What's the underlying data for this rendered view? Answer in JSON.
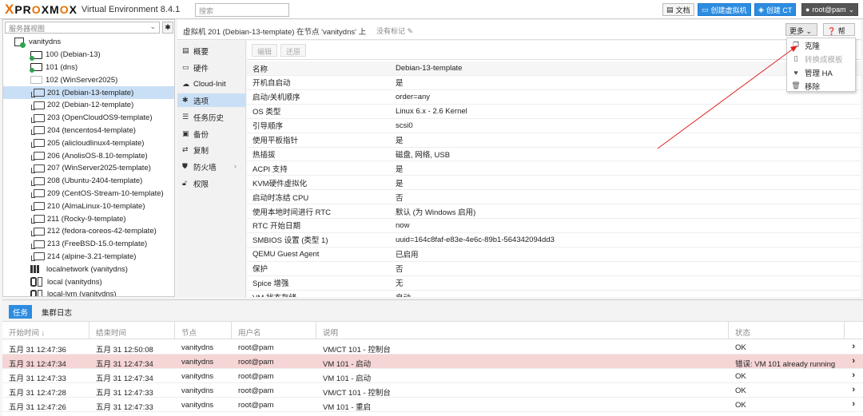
{
  "topbar": {
    "logo_x": "X",
    "logo_word_a": "PR",
    "logo_word_o": "O",
    "logo_word_b": "XM",
    "logo_word_o2": "O",
    "logo_word_c": "X",
    "version": "Virtual Environment 8.4.1",
    "search_placeholder": "搜索",
    "docs": "文档",
    "create_vm": "创建虚拟机",
    "create_ct": "创建 CT",
    "user": "root@pam"
  },
  "left": {
    "view_label": "服务器视图",
    "tree": [
      {
        "label": "vanitydns",
        "kind": "node"
      },
      {
        "label": "100 (Debian-13)",
        "kind": "vm-run"
      },
      {
        "label": "101 (dns)",
        "kind": "vm-run"
      },
      {
        "label": "102 (WinServer2025)",
        "kind": "vm-off"
      },
      {
        "label": "201 (Debian-13-template)",
        "kind": "tmpl"
      },
      {
        "label": "202 (Debian-12-template)",
        "kind": "tmpl"
      },
      {
        "label": "203 (OpenCloudOS9-template)",
        "kind": "tmpl"
      },
      {
        "label": "204 (tencentos4-template)",
        "kind": "tmpl"
      },
      {
        "label": "205 (alicloudlinux4-template)",
        "kind": "tmpl"
      },
      {
        "label": "206 (AnolisOS-8.10-template)",
        "kind": "tmpl"
      },
      {
        "label": "207 (WinServer2025-template)",
        "kind": "tmpl"
      },
      {
        "label": "208 (Ubuntu-2404-template)",
        "kind": "tmpl"
      },
      {
        "label": "209 (CentOS-Stream-10-template)",
        "kind": "tmpl"
      },
      {
        "label": "210 (AlmaLinux-10-template)",
        "kind": "tmpl"
      },
      {
        "label": "211 (Rocky-9-template)",
        "kind": "tmpl"
      },
      {
        "label": "212 (fedora-coreos-42-template)",
        "kind": "tmpl"
      },
      {
        "label": "213 (FreeBSD-15.0-template)",
        "kind": "tmpl"
      },
      {
        "label": "214 (alpine-3.21-template)",
        "kind": "tmpl"
      },
      {
        "label": "localnetwork (vanitydns)",
        "kind": "net"
      },
      {
        "label": "local (vanitydns)",
        "kind": "storage"
      },
      {
        "label": "local-lvm (vanitydns)",
        "kind": "storage"
      }
    ]
  },
  "header": {
    "title": "虚拟机 201 (Debian-13-template) 在节点 'vanitydns' 上",
    "tags": "没有标记",
    "more": "更多",
    "help": "帮助"
  },
  "menu": [
    {
      "label": "概要",
      "icon": "book-icon"
    },
    {
      "label": "硬件",
      "icon": "monitor-icon"
    },
    {
      "label": "Cloud-Init",
      "icon": "cloud-icon"
    },
    {
      "label": "选项",
      "icon": "gear-icon"
    },
    {
      "label": "任务历史",
      "icon": "list-icon"
    },
    {
      "label": "备份",
      "icon": "floppy-icon"
    },
    {
      "label": "复制",
      "icon": "retweet-icon"
    },
    {
      "label": "防火墙",
      "icon": "shield-icon"
    },
    {
      "label": "权限",
      "icon": "unlock-icon"
    }
  ],
  "editbar": {
    "edit": "编辑",
    "revert": "还原"
  },
  "options": [
    {
      "key": "名称",
      "value": "Debian-13-template"
    },
    {
      "key": "开机自启动",
      "value": "是"
    },
    {
      "key": "启动/关机顺序",
      "value": "order=any"
    },
    {
      "key": "OS 类型",
      "value": "Linux 6.x - 2.6 Kernel"
    },
    {
      "key": "引导顺序",
      "value": "scsi0"
    },
    {
      "key": "使用平板指针",
      "value": "是"
    },
    {
      "key": "热插拔",
      "value": "磁盘, 网络, USB"
    },
    {
      "key": "ACPI 支持",
      "value": "是"
    },
    {
      "key": "KVM硬件虚拟化",
      "value": "是"
    },
    {
      "key": "启动时冻结 CPU",
      "value": "否"
    },
    {
      "key": "使用本地时间进行 RTC",
      "value": "默认 (为 Windows 启用)"
    },
    {
      "key": "RTC 开始日期",
      "value": "now"
    },
    {
      "key": "SMBIOS 设置 (类型 1)",
      "value": "uuid=164c8faf-e83e-4e6c-89b1-564342094dd3"
    },
    {
      "key": "QEMU Guest Agent",
      "value": "已启用"
    },
    {
      "key": "保护",
      "value": "否"
    },
    {
      "key": "Spice 增强",
      "value": "无"
    },
    {
      "key": "VM 状态存储",
      "value": "自动"
    }
  ],
  "dropdown": [
    {
      "label": "克隆",
      "icon": "clone-icon",
      "disabled": false
    },
    {
      "label": "转换成模板",
      "icon": "file-icon",
      "disabled": true
    },
    {
      "label": "管理 HA",
      "icon": "heartbeat-icon",
      "disabled": false
    },
    {
      "label": "移除",
      "icon": "trash-icon",
      "disabled": false
    }
  ],
  "tasks": {
    "tab_tasks": "任务",
    "tab_log": "集群日志",
    "columns": [
      "开始时间 ↓",
      "结束时间",
      "节点",
      "用户名",
      "说明",
      "状态"
    ],
    "rows": [
      {
        "start": "五月 31 12:47:36",
        "end": "五月 31 12:50:08",
        "node": "vanitydns",
        "user": "root@pam",
        "desc": "VM/CT 101 - 控制台",
        "status": "OK",
        "error": false
      },
      {
        "start": "五月 31 12:47:34",
        "end": "五月 31 12:47:34",
        "node": "vanitydns",
        "user": "root@pam",
        "desc": "VM 101 - 启动",
        "status": "错误: VM 101 already running",
        "error": true
      },
      {
        "start": "五月 31 12:47:33",
        "end": "五月 31 12:47:34",
        "node": "vanitydns",
        "user": "root@pam",
        "desc": "VM 101 - 启动",
        "status": "OK",
        "error": false
      },
      {
        "start": "五月 31 12:47:28",
        "end": "五月 31 12:47:33",
        "node": "vanitydns",
        "user": "root@pam",
        "desc": "VM/CT 101 - 控制台",
        "status": "OK",
        "error": false
      },
      {
        "start": "五月 31 12:47:26",
        "end": "五月 31 12:47:33",
        "node": "vanitydns",
        "user": "root@pam",
        "desc": "VM 101 - 重启",
        "status": "OK",
        "error": false
      }
    ]
  },
  "colors": {
    "accent": "#2c8ce0",
    "selected": "#c9dff5",
    "error_row": "#f5d5d5",
    "running": "#2ea44f",
    "annotation": "#e02020",
    "brand": "#e57000"
  }
}
